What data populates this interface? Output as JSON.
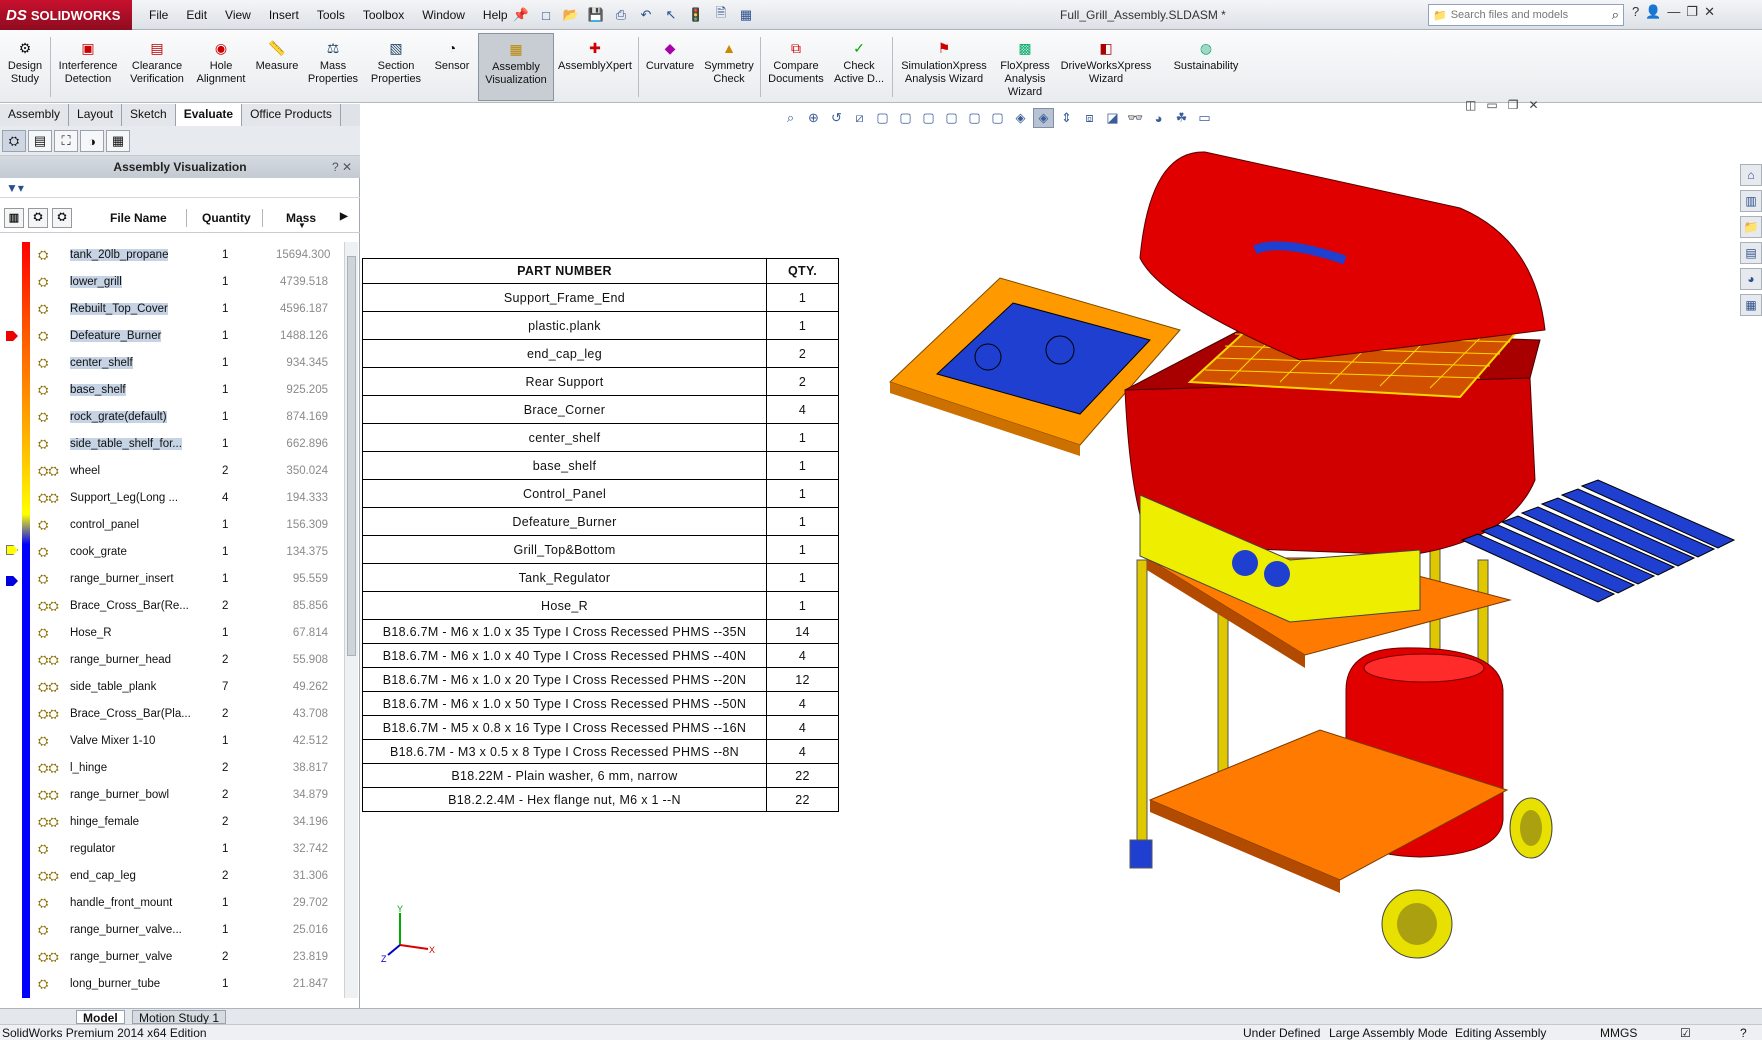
{
  "window": {
    "app_name": "SOLIDWORKS",
    "app_brand_prefix": "DS",
    "document_title": "Full_Grill_Assembly.SLDASM *",
    "menu": [
      "File",
      "Edit",
      "View",
      "Insert",
      "Tools",
      "Toolbox",
      "Window",
      "Help"
    ],
    "search_placeholder": "Search files and models"
  },
  "command_manager": {
    "buttons": [
      {
        "label": "Design Study",
        "icon": "design-study-icon"
      },
      {
        "label": "Interference Detection",
        "icon": "interference-icon"
      },
      {
        "label": "Clearance Verification",
        "icon": "clearance-icon"
      },
      {
        "label": "Hole Alignment",
        "icon": "hole-alignment-icon"
      },
      {
        "label": "Measure",
        "icon": "measure-icon"
      },
      {
        "label": "Mass Properties",
        "icon": "mass-properties-icon"
      },
      {
        "label": "Section Properties",
        "icon": "section-properties-icon"
      },
      {
        "label": "Sensor",
        "icon": "sensor-icon"
      },
      {
        "label": "Assembly Visualization",
        "icon": "assembly-visualization-icon"
      },
      {
        "label": "AssemblyXpert",
        "icon": "assemblyxpert-icon"
      },
      {
        "label": "Curvature",
        "icon": "curvature-icon"
      },
      {
        "label": "Symmetry Check",
        "icon": "symmetry-check-icon"
      },
      {
        "label": "Compare Documents",
        "icon": "compare-documents-icon"
      },
      {
        "label": "Check Active D...",
        "icon": "check-active-icon"
      },
      {
        "label": "SimulationXpress Analysis Wizard",
        "icon": "simulationxpress-icon"
      },
      {
        "label": "FloXpress Analysis Wizard",
        "icon": "floxpress-icon"
      },
      {
        "label": "DriveWorksXpress Wizard",
        "icon": "driveworksxpress-icon"
      },
      {
        "label": "Sustainability",
        "icon": "sustainability-icon"
      }
    ],
    "tabs": [
      "Assembly",
      "Layout",
      "Sketch",
      "Evaluate",
      "Office Products"
    ],
    "selected_tab": "Evaluate"
  },
  "panel": {
    "title": "Assembly Visualization",
    "columns": {
      "name": "File Name",
      "quantity": "Quantity",
      "mass": "Mass"
    },
    "rows": [
      {
        "name": "tank_20lb_propane",
        "qty": "1",
        "mass": "15694.300"
      },
      {
        "name": "lower_grill",
        "qty": "1",
        "mass": "4739.518"
      },
      {
        "name": "Rebuilt_Top_Cover",
        "qty": "1",
        "mass": "4596.187"
      },
      {
        "name": "Defeature_Burner",
        "qty": "1",
        "mass": "1488.126"
      },
      {
        "name": "center_shelf",
        "qty": "1",
        "mass": "934.345"
      },
      {
        "name": "base_shelf",
        "qty": "1",
        "mass": "925.205"
      },
      {
        "name": "rock_grate(default)",
        "qty": "1",
        "mass": "874.169"
      },
      {
        "name": "side_table_shelf_for...",
        "qty": "1",
        "mass": "662.896"
      },
      {
        "name": "wheel",
        "qty": "2",
        "mass": "350.024"
      },
      {
        "name": "Support_Leg(Long ...",
        "qty": "4",
        "mass": "194.333"
      },
      {
        "name": "control_panel",
        "qty": "1",
        "mass": "156.309"
      },
      {
        "name": "cook_grate",
        "qty": "1",
        "mass": "134.375"
      },
      {
        "name": "range_burner_insert",
        "qty": "1",
        "mass": "95.559"
      },
      {
        "name": "Brace_Cross_Bar(Re...",
        "qty": "2",
        "mass": "85.856"
      },
      {
        "name": "Hose_R",
        "qty": "1",
        "mass": "67.814"
      },
      {
        "name": "range_burner_head",
        "qty": "2",
        "mass": "55.908"
      },
      {
        "name": "side_table_plank",
        "qty": "7",
        "mass": "49.262"
      },
      {
        "name": "Brace_Cross_Bar(Pla...",
        "qty": "2",
        "mass": "43.708"
      },
      {
        "name": "Valve Mixer 1-10",
        "qty": "1",
        "mass": "42.512"
      },
      {
        "name": "l_hinge",
        "qty": "2",
        "mass": "38.817"
      },
      {
        "name": "range_burner_bowl",
        "qty": "2",
        "mass": "34.879"
      },
      {
        "name": "hinge_female",
        "qty": "2",
        "mass": "34.196"
      },
      {
        "name": "regulator",
        "qty": "1",
        "mass": "32.742"
      },
      {
        "name": "end_cap_leg",
        "qty": "2",
        "mass": "31.306"
      },
      {
        "name": "handle_front_mount",
        "qty": "1",
        "mass": "29.702"
      },
      {
        "name": "range_burner_valve...",
        "qty": "1",
        "mass": "25.016"
      },
      {
        "name": "range_burner_valve",
        "qty": "2",
        "mass": "23.819"
      },
      {
        "name": "long_burner_tube",
        "qty": "1",
        "mass": "21.847"
      }
    ]
  },
  "bom": {
    "headers": [
      "PART NUMBER",
      "QTY."
    ],
    "rows": [
      [
        "Support_Frame_End",
        "1"
      ],
      [
        "plastic.plank",
        "1"
      ],
      [
        "end_cap_leg",
        "2"
      ],
      [
        "Rear Support",
        "2"
      ],
      [
        "Brace_Corner",
        "4"
      ],
      [
        "center_shelf",
        "1"
      ],
      [
        "base_shelf",
        "1"
      ],
      [
        "Control_Panel",
        "1"
      ],
      [
        "Defeature_Burner",
        "1"
      ],
      [
        "Grill_Top&Bottom",
        "1"
      ],
      [
        "Tank_Regulator",
        "1"
      ],
      [
        "Hose_R",
        "1"
      ],
      [
        "B18.6.7M - M6 x 1.0 x 35 Type I Cross Recessed PHMS --35N",
        "14"
      ],
      [
        "B18.6.7M - M6 x 1.0 x 40 Type I Cross Recessed PHMS --40N",
        "4"
      ],
      [
        "B18.6.7M - M6 x 1.0 x 20 Type I Cross Recessed PHMS --20N",
        "12"
      ],
      [
        "B18.6.7M - M6 x 1.0 x 50 Type I Cross Recessed PHMS --50N",
        "4"
      ],
      [
        "B18.6.7M - M5 x 0.8 x 16 Type I Cross Recessed PHMS --16N",
        "4"
      ],
      [
        "B18.6.7M - M3 x 0.5 x 8 Type I Cross Recessed PHMS --8N",
        "4"
      ],
      [
        "B18.22M - Plain washer, 6 mm, narrow",
        "22"
      ],
      [
        "B18.2.2.4M - Hex flange nut, M6 x 1 --N",
        "22"
      ]
    ]
  },
  "bottom_tabs": [
    "Model",
    "Motion Study 1"
  ],
  "status": {
    "edition": "SolidWorks Premium 2014 x64 Edition",
    "state": "Under Defined",
    "mode": "Large Assembly Mode",
    "editing": "Editing Assembly",
    "units": "MMGS"
  },
  "triad_labels": {
    "x": "X",
    "y": "Y",
    "z": "Z"
  },
  "colors": {
    "accent": "#c8102e",
    "high": "#ff0000",
    "mid": "#ffff00",
    "low": "#0000ff"
  }
}
